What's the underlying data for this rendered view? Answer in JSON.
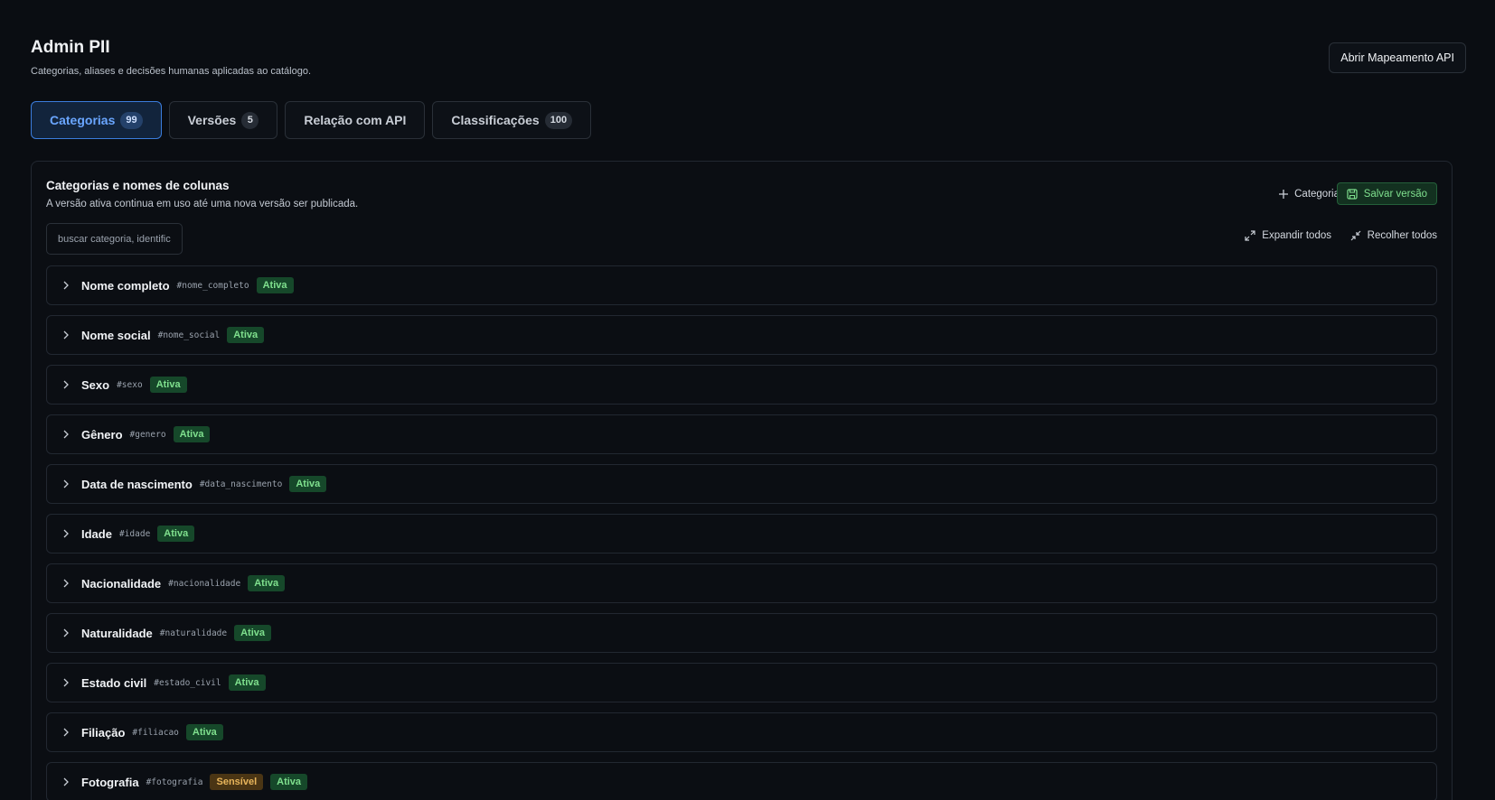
{
  "header": {
    "title": "Admin PII",
    "subtitle": "Categorias, aliases e decisões humanas aplicadas ao catálogo.",
    "api_button": "Abrir Mapeamento API"
  },
  "tabs": [
    {
      "label": "Categorias",
      "count": "99",
      "active": true
    },
    {
      "label": "Versões",
      "count": "5",
      "active": false
    },
    {
      "label": "Relação com API",
      "count": "",
      "active": false
    },
    {
      "label": "Classificações",
      "count": "100",
      "active": false
    }
  ],
  "panel": {
    "title": "Categorias e nomes de colunas",
    "description": "A versão ativa continua em uso até uma nova versão ser publicada.",
    "add_category": "Categoria",
    "save_version": "Salvar versão",
    "search_placeholder": "buscar categoria, identific",
    "expand_all": "Expandir todos",
    "collapse_all": "Recolher todos"
  },
  "categories": [
    {
      "name": "Nome completo",
      "id": "#nome_completo",
      "badges": [
        "Ativa"
      ]
    },
    {
      "name": "Nome social",
      "id": "#nome_social",
      "badges": [
        "Ativa"
      ]
    },
    {
      "name": "Sexo",
      "id": "#sexo",
      "badges": [
        "Ativa"
      ]
    },
    {
      "name": "Gênero",
      "id": "#genero",
      "badges": [
        "Ativa"
      ]
    },
    {
      "name": "Data de nascimento",
      "id": "#data_nascimento",
      "badges": [
        "Ativa"
      ]
    },
    {
      "name": "Idade",
      "id": "#idade",
      "badges": [
        "Ativa"
      ]
    },
    {
      "name": "Nacionalidade",
      "id": "#nacionalidade",
      "badges": [
        "Ativa"
      ]
    },
    {
      "name": "Naturalidade",
      "id": "#naturalidade",
      "badges": [
        "Ativa"
      ]
    },
    {
      "name": "Estado civil",
      "id": "#estado_civil",
      "badges": [
        "Ativa"
      ]
    },
    {
      "name": "Filiação",
      "id": "#filiacao",
      "badges": [
        "Ativa"
      ]
    },
    {
      "name": "Fotografia",
      "id": "#fotografia",
      "badges": [
        "Sensível",
        "Ativa"
      ]
    }
  ],
  "colors": {
    "background": "#0a0d12",
    "accent": "#3b7ddd",
    "success": "#7fe08e",
    "warning": "#e8b55b"
  },
  "icons": {
    "add": "plus-icon",
    "save": "save-icon",
    "expand": "expand-icon",
    "collapse": "collapse-icon",
    "row": "chevron-right-icon"
  }
}
